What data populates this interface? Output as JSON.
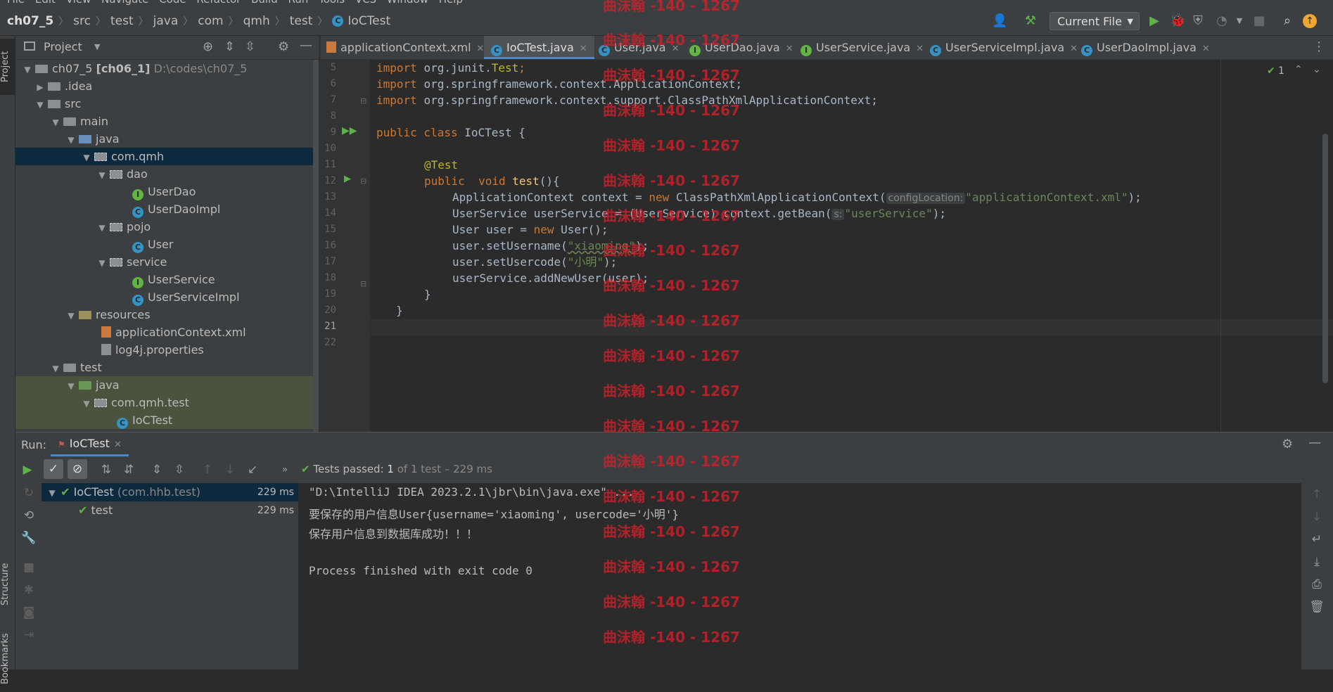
{
  "menu": [
    "File",
    "Edit",
    "View",
    "Navigate",
    "Code",
    "Refactor",
    "Build",
    "Run",
    "Tools",
    "VCS",
    "Window",
    "Help"
  ],
  "breadcrumbs": [
    "ch07_5",
    "src",
    "test",
    "java",
    "com",
    "qmh",
    "test",
    "IoCTest"
  ],
  "toolbar": {
    "run_config": "Current File"
  },
  "left_stripe": {
    "project": "Project",
    "structure": "Structure",
    "bookmarks": "Bookmarks"
  },
  "project_panel": {
    "title": "Project",
    "tree": [
      {
        "label": "ch07_5",
        "bold_suffix": "[ch06_1]",
        "path": "D:\\codes\\ch07_5"
      },
      {
        "label": ".idea"
      },
      {
        "label": "src"
      },
      {
        "label": "main"
      },
      {
        "label": "java"
      },
      {
        "label": "com.qmh"
      },
      {
        "label": "dao"
      },
      {
        "label": "UserDao"
      },
      {
        "label": "UserDaoImpl"
      },
      {
        "label": "pojo"
      },
      {
        "label": "User"
      },
      {
        "label": "service"
      },
      {
        "label": "UserService"
      },
      {
        "label": "UserServiceImpl"
      },
      {
        "label": "resources"
      },
      {
        "label": "applicationContext.xml"
      },
      {
        "label": "log4j.properties"
      },
      {
        "label": "test"
      },
      {
        "label": "java"
      },
      {
        "label": "com.qmh.test"
      },
      {
        "label": "IoCTest"
      }
    ]
  },
  "tabs": [
    {
      "label": "applicationContext.xml"
    },
    {
      "label": "IoCTest.java"
    },
    {
      "label": "User.java"
    },
    {
      "label": "UserDao.java"
    },
    {
      "label": "UserService.java"
    },
    {
      "label": "UserServiceImpl.java"
    },
    {
      "label": "UserDaoImpl.java"
    }
  ],
  "editor": {
    "inspections": "1",
    "line_numbers": [
      "5",
      "6",
      "7",
      "8",
      "9",
      "10",
      "11",
      "12",
      "13",
      "14",
      "15",
      "16",
      "17",
      "18",
      "19",
      "20",
      "21",
      "22"
    ],
    "code": {
      "l5_kw": "import ",
      "l5_rest": "org.junit.",
      "l5_an": "Test",
      "l5_end": ";",
      "l6_kw": "import ",
      "l6_rest": "org.springframework.context.ApplicationContext;",
      "l7_kw": "import ",
      "l7_rest": "org.springframework.context.support.ClassPathXmlApplicationContext;",
      "l9_kw": "public class ",
      "l9_rest": "IoCTest {",
      "l11_an": "@Test",
      "l12_kw": "public  void ",
      "l12_fn": "test",
      "l12_rest": "(){",
      "l13_a": "ApplicationContext context = ",
      "l13_kw": "new ",
      "l13_b": "ClassPathXmlApplicationContext(",
      "l13_hint": "configLocation:",
      "l13_str": "\"applicationContext.xml\"",
      "l13_end": ");",
      "l14_a": "UserService userService = (UserService) context.getBean(",
      "l14_hint": "s:",
      "l14_str": "\"userService\"",
      "l14_end": ");",
      "l15_a": "User user = ",
      "l15_kw": "new ",
      "l15_b": "User();",
      "l16_a": "user.setUsername(",
      "l16_str": "\"xiaoming\"",
      "l16_end": ");",
      "l17_a": "user.setUsercode(",
      "l17_str": "\"小明\"",
      "l17_end": ");",
      "l18_a": "userService.addNewUser(user);",
      "l19_a": "}",
      "l20_a": "}"
    }
  },
  "run_panel": {
    "label": "Run:",
    "tab": "IoCTest",
    "status_prefix": "Tests passed:",
    "status_count": "1",
    "status_suffix": "of 1 test – 229 ms",
    "tree": [
      {
        "label": "IoCTest",
        "suffix": "(com.hhb.test)",
        "time": "229 ms"
      },
      {
        "label": "test",
        "time": "229 ms"
      }
    ],
    "console": [
      "\"D:\\IntelliJ IDEA 2023.2.1\\jbr\\bin\\java.exe\" ...",
      "要保存的用户信息User{username='xiaoming', usercode='小明'}",
      "保存用户信息到数据库成功！！！",
      "",
      "Process finished with exit code 0"
    ]
  },
  "watermark": "曲沫翰 -140 - 1267",
  "colors": {
    "accent": "#4a88c7",
    "keyword": "#cc7832",
    "string": "#6a8759",
    "annotation": "#bbb529",
    "pass": "#5fb14b",
    "watermark": "#d0202a"
  }
}
